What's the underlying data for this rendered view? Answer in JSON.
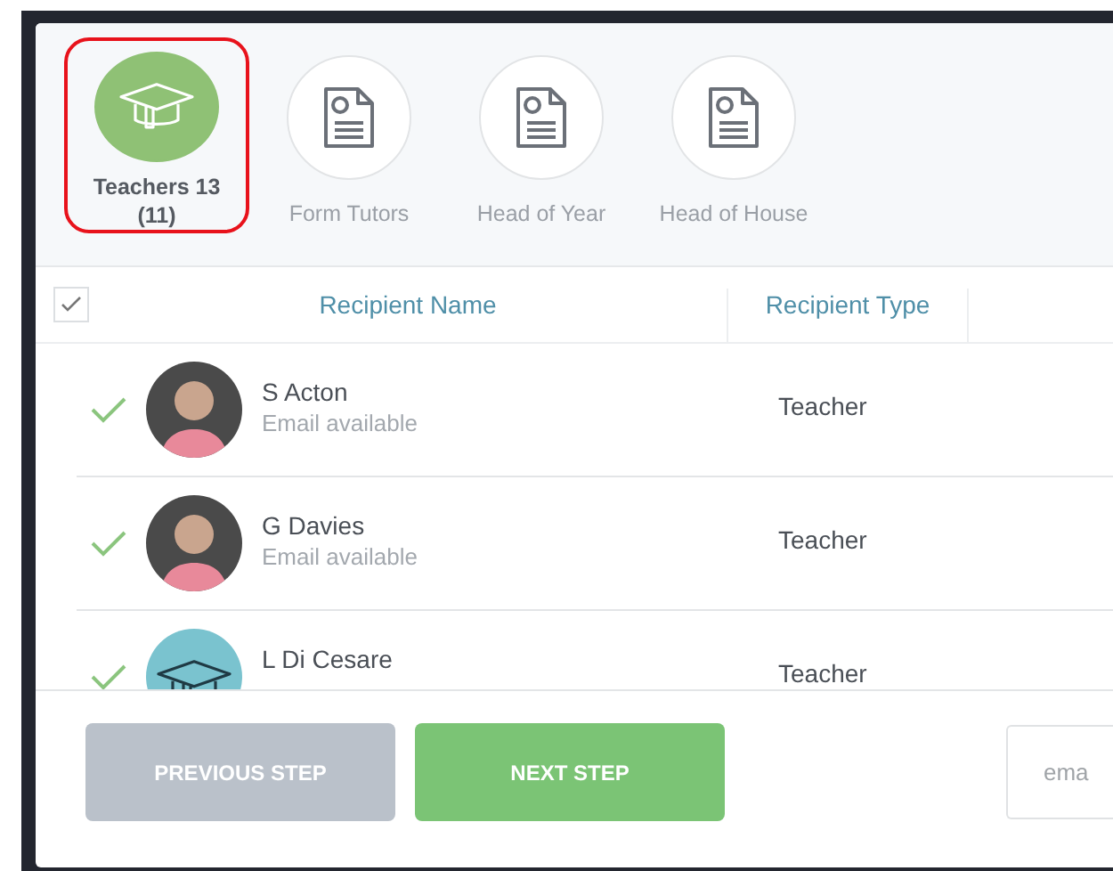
{
  "groups": [
    {
      "label": "Teachers 13\n(11)",
      "kind": "cap",
      "selected": true
    },
    {
      "label": "Form Tutors",
      "kind": "document",
      "selected": false
    },
    {
      "label": "Head of Year",
      "kind": "document",
      "selected": false
    },
    {
      "label": "Head of House",
      "kind": "document",
      "selected": false
    }
  ],
  "table": {
    "select_all": {
      "checked": true
    },
    "columns": [
      "Recipient Name",
      "Recipient Type"
    ],
    "rows": [
      {
        "name": "S Acton",
        "detail": "Email available",
        "type": "Teacher",
        "checked": true,
        "kind": "photo"
      },
      {
        "name": "G Davies",
        "detail": "Email available",
        "type": "Teacher",
        "checked": true,
        "kind": "photo"
      },
      {
        "name": "L Di Cesare",
        "type": "Teacher",
        "checked": true,
        "kind": "cap"
      }
    ]
  },
  "footer": {
    "buttons": [
      {
        "label": "PREVIOUS STEP",
        "kind": "secondary"
      },
      {
        "label": "NEXT STEP",
        "kind": "primary"
      }
    ],
    "email_field": {
      "placeholder": "ema"
    }
  }
}
